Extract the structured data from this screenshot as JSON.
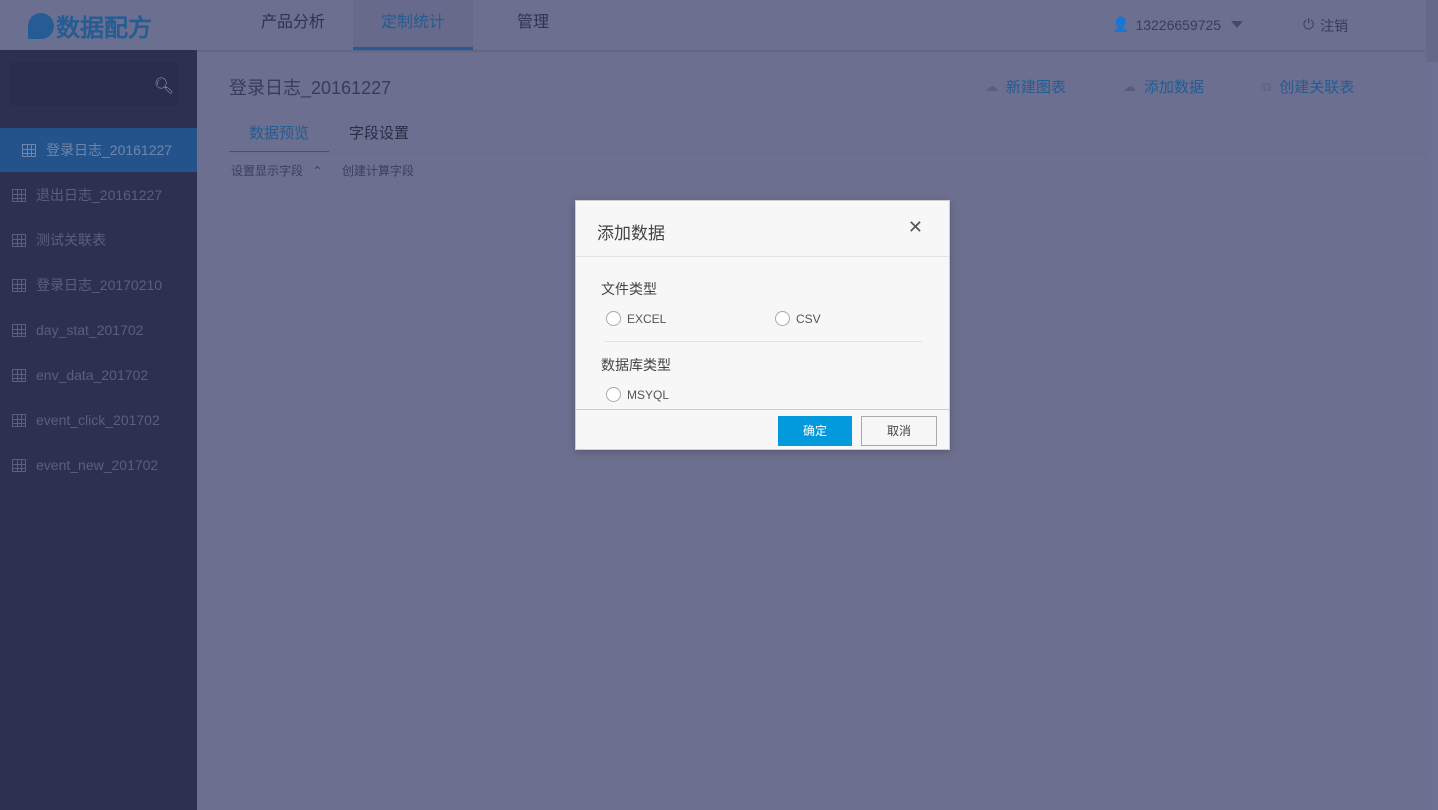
{
  "header": {
    "logo": "数据配方",
    "nav": [
      "产品分析",
      "定制统计",
      "管理"
    ],
    "user": "13226659725",
    "logout": "注销"
  },
  "sidebar": {
    "items": [
      "登录日志_20161227",
      "退出日志_20161227",
      "测试关联表",
      "登录日志_20170210",
      "day_stat_201702",
      "env_data_201702",
      "event_click_201702",
      "event_new_201702"
    ]
  },
  "main": {
    "title": "登录日志_20161227",
    "actions": [
      "新建图表",
      "添加数据",
      "创建关联表"
    ],
    "tabs": [
      "数据预览",
      "字段设置"
    ],
    "sub": [
      "设置显示字段",
      "创建计算字段"
    ]
  },
  "modal": {
    "title": "添加数据",
    "file_type_label": "文件类型",
    "file_options": [
      "EXCEL",
      "CSV"
    ],
    "db_type_label": "数据库类型",
    "db_options": [
      "MSYQL"
    ],
    "ok": "确定",
    "cancel": "取消"
  }
}
